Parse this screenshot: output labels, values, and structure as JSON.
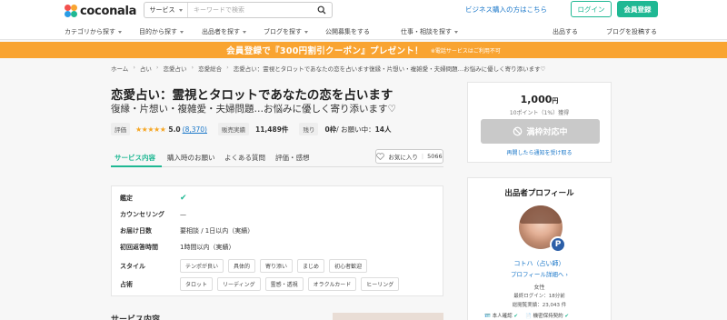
{
  "header": {
    "logo_text": "coconala",
    "search_category": "サービス",
    "search_placeholder": "キーワードで検索",
    "business_link": "ビジネス購入の方はこちら",
    "login_label": "ログイン",
    "register_label": "会員登録"
  },
  "nav": {
    "items": [
      "カテゴリから探す",
      "目的から探す",
      "出品者を探す",
      "ブログを探す",
      "公開募集をする",
      "仕事・相談を探す"
    ],
    "right_items": [
      "出品する",
      "ブログを投稿する"
    ]
  },
  "banner": {
    "main": "会員登録で『300円割引クーポン』プレゼント！",
    "note": "※電話サービスはご利用不可"
  },
  "breadcrumb": [
    "ホーム",
    "占い",
    "恋愛占い",
    "恋愛総合",
    "恋愛占い：霊視とタロットであなたの恋を占います復縁・片想い・複雑愛・夫婦問題…お悩みに優しく寄り添います♡"
  ],
  "service": {
    "title": "恋愛占い：霊視とタロットであなたの恋を占います",
    "subtitle": "復縁・片想い・複雑愛・夫婦問題…お悩みに優しく寄り添います♡",
    "rating_label": "評価",
    "stars": "★★★★★",
    "rating": "5.0",
    "rating_count": "(8,370)",
    "sales_label": "販売実績",
    "sales_value": "11,489件",
    "remaining_label": "残り",
    "remaining_value": "0枠",
    "waiting_label": " / お願い中：",
    "waiting_value": "14人"
  },
  "tabs": {
    "items": [
      "サービス内容",
      "購入時のお願い",
      "よくある質問",
      "評価・感想"
    ],
    "favorite_label": "お気に入り",
    "favorite_count": "5066"
  },
  "details": {
    "rows": [
      {
        "label": "鑑定",
        "value": "✔"
      },
      {
        "label": "カウンセリング",
        "value": "—"
      },
      {
        "label": "お届け日数",
        "value": "要相談 / 1日以内（実績）"
      },
      {
        "label": "初回返答時間",
        "value": "1時間以内（実績）"
      }
    ],
    "style_label": "スタイル",
    "style_chips": [
      "テンポが良い",
      "具体的",
      "寄り添い",
      "まじめ",
      "初心者歓迎"
    ],
    "method_label": "占術",
    "method_chips": [
      "タロット",
      "リーディング",
      "霊感・透視",
      "オラクルカード",
      "ヒーリング"
    ],
    "next_section": "サービス内容"
  },
  "price": {
    "amount": "1,000",
    "unit": "円",
    "fee": "10ポイント（1%）獲得",
    "full_label": "満枠対応中",
    "notify_link": "再開したら通知を受け取る"
  },
  "profile": {
    "title": "出品者プロフィール",
    "badge": "P",
    "name": "コトハ（占い師）",
    "detail_link": "プロフィール詳細へ",
    "gender": "女性",
    "last_login": "最終ログイン：18分前",
    "views": "総閲覧実績：23,043 件",
    "verify_id": "本人確認",
    "verify_nda": "機密保持契約"
  },
  "colors": {
    "brand_green": "#1fb893",
    "banner_orange": "#f9a431",
    "link_blue": "#1a77c9",
    "star_orange": "#f6a623"
  }
}
